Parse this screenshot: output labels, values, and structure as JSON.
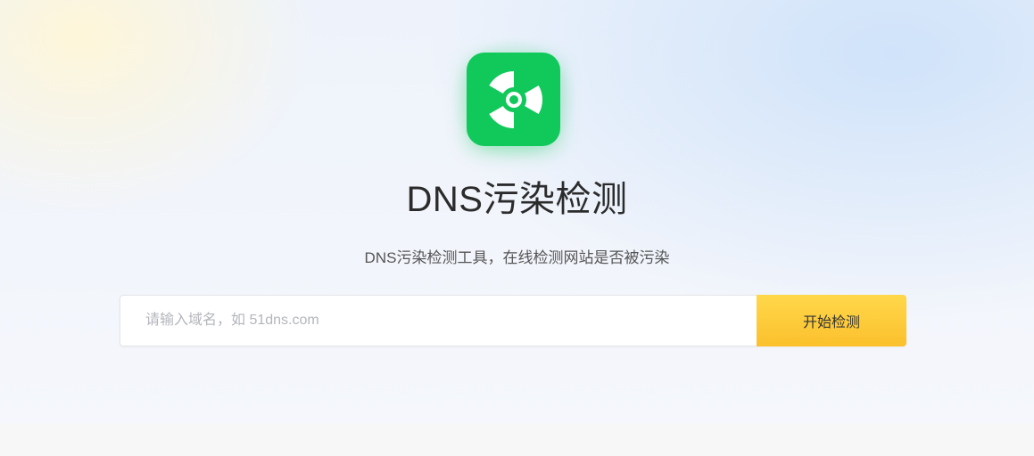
{
  "header": {
    "icon": "radiation-icon",
    "title": "DNS污染检测",
    "subtitle": "DNS污染检测工具，在线检测网站是否被污染"
  },
  "search": {
    "placeholder": "请输入域名，如 51dns.com",
    "value": "",
    "button_label": "开始检测"
  },
  "colors": {
    "logo_bg": "#10c95a",
    "button_bg": "#fbc02d",
    "title_text": "#2b2b2b"
  }
}
